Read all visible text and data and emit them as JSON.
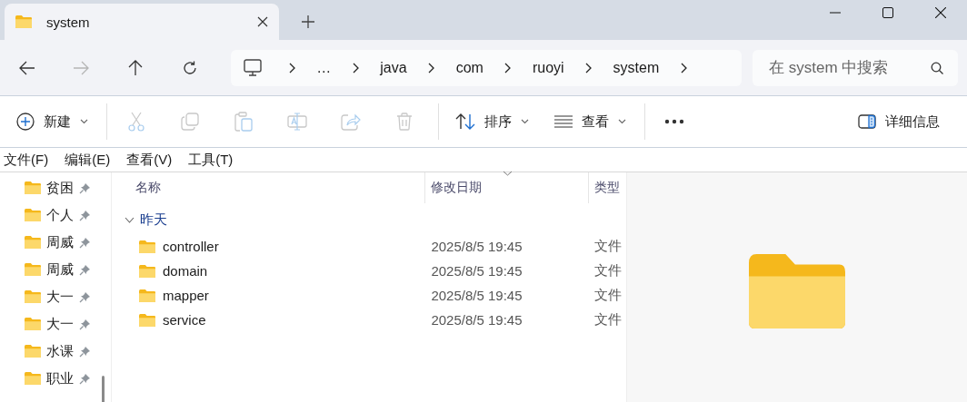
{
  "tabs": [
    {
      "label": "system",
      "selected": true
    }
  ],
  "navigation": {
    "back_disabled": false,
    "forward_disabled": true
  },
  "breadcrumb": [
    "…",
    "java",
    "com",
    "ruoyi",
    "system"
  ],
  "search": {
    "placeholder": "在 system 中搜索"
  },
  "toolbar": [
    {
      "kind": "new",
      "label": "新建",
      "disabled": false
    },
    {
      "kind": "cut",
      "disabled": true
    },
    {
      "kind": "copy",
      "disabled": true
    },
    {
      "kind": "paste",
      "disabled": true
    },
    {
      "kind": "rename",
      "disabled": true
    },
    {
      "kind": "share",
      "disabled": true
    },
    {
      "kind": "delete",
      "disabled": true
    },
    {
      "kind": "sort",
      "label": "排序",
      "disabled": false
    },
    {
      "kind": "view",
      "label": "查看",
      "disabled": false
    },
    {
      "kind": "more",
      "disabled": false
    }
  ],
  "details_button": {
    "label": "详细信息"
  },
  "menu_bar": [
    "文件(F)",
    "编辑(E)",
    "查看(V)",
    "工具(T)"
  ],
  "sidebar": {
    "items": [
      {
        "label": "贫困",
        "pinned": true
      },
      {
        "label": "个人",
        "pinned": true
      },
      {
        "label": "周威",
        "pinned": true
      },
      {
        "label": "周威",
        "pinned": true
      },
      {
        "label": "大一",
        "pinned": true
      },
      {
        "label": "大一",
        "pinned": true
      },
      {
        "label": "水课",
        "pinned": true
      },
      {
        "label": "职业",
        "pinned": true
      }
    ]
  },
  "table": {
    "columns": [
      {
        "label": "名称",
        "sorted": false
      },
      {
        "label": "修改日期",
        "sorted": true
      },
      {
        "label": "类型",
        "sorted": false
      }
    ],
    "groups": [
      {
        "label": "昨天",
        "expanded": true,
        "rows": [
          {
            "name": "controller",
            "modified": "2025/8/5 19:45",
            "type": "文件"
          },
          {
            "name": "domain",
            "modified": "2025/8/5 19:45",
            "type": "文件"
          },
          {
            "name": "mapper",
            "modified": "2025/8/5 19:45",
            "type": "文件"
          },
          {
            "name": "service",
            "modified": "2025/8/5 19:45",
            "type": "文件"
          }
        ]
      }
    ]
  }
}
